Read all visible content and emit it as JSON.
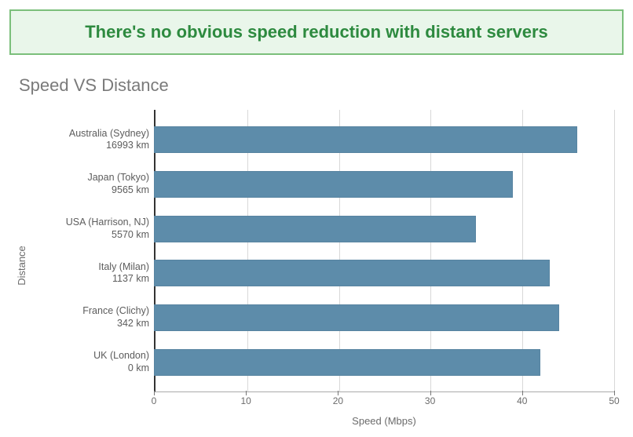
{
  "banner": {
    "text": "There's no obvious speed reduction with distant servers"
  },
  "chart_data": {
    "type": "bar",
    "title": "Speed VS Distance",
    "xlabel": "Speed (Mbps)",
    "ylabel": "Distance",
    "xlim": [
      0,
      50
    ],
    "xticks": [
      0,
      10,
      20,
      30,
      40,
      50
    ],
    "grid": true,
    "categories": [
      {
        "location": "Australia (Sydney)",
        "distance": "16993 km"
      },
      {
        "location": "Japan (Tokyo)",
        "distance": "9565 km"
      },
      {
        "location": "USA (Harrison, NJ)",
        "distance": "5570 km"
      },
      {
        "location": "Italy (Milan)",
        "distance": "1137 km"
      },
      {
        "location": "France (Clichy)",
        "distance": "342 km"
      },
      {
        "location": "UK (London)",
        "distance": "0 km"
      }
    ],
    "values": [
      46,
      39,
      35,
      43,
      44,
      42
    ],
    "bar_color": "#5d8caa",
    "accent_color": "#2d8a3f"
  }
}
